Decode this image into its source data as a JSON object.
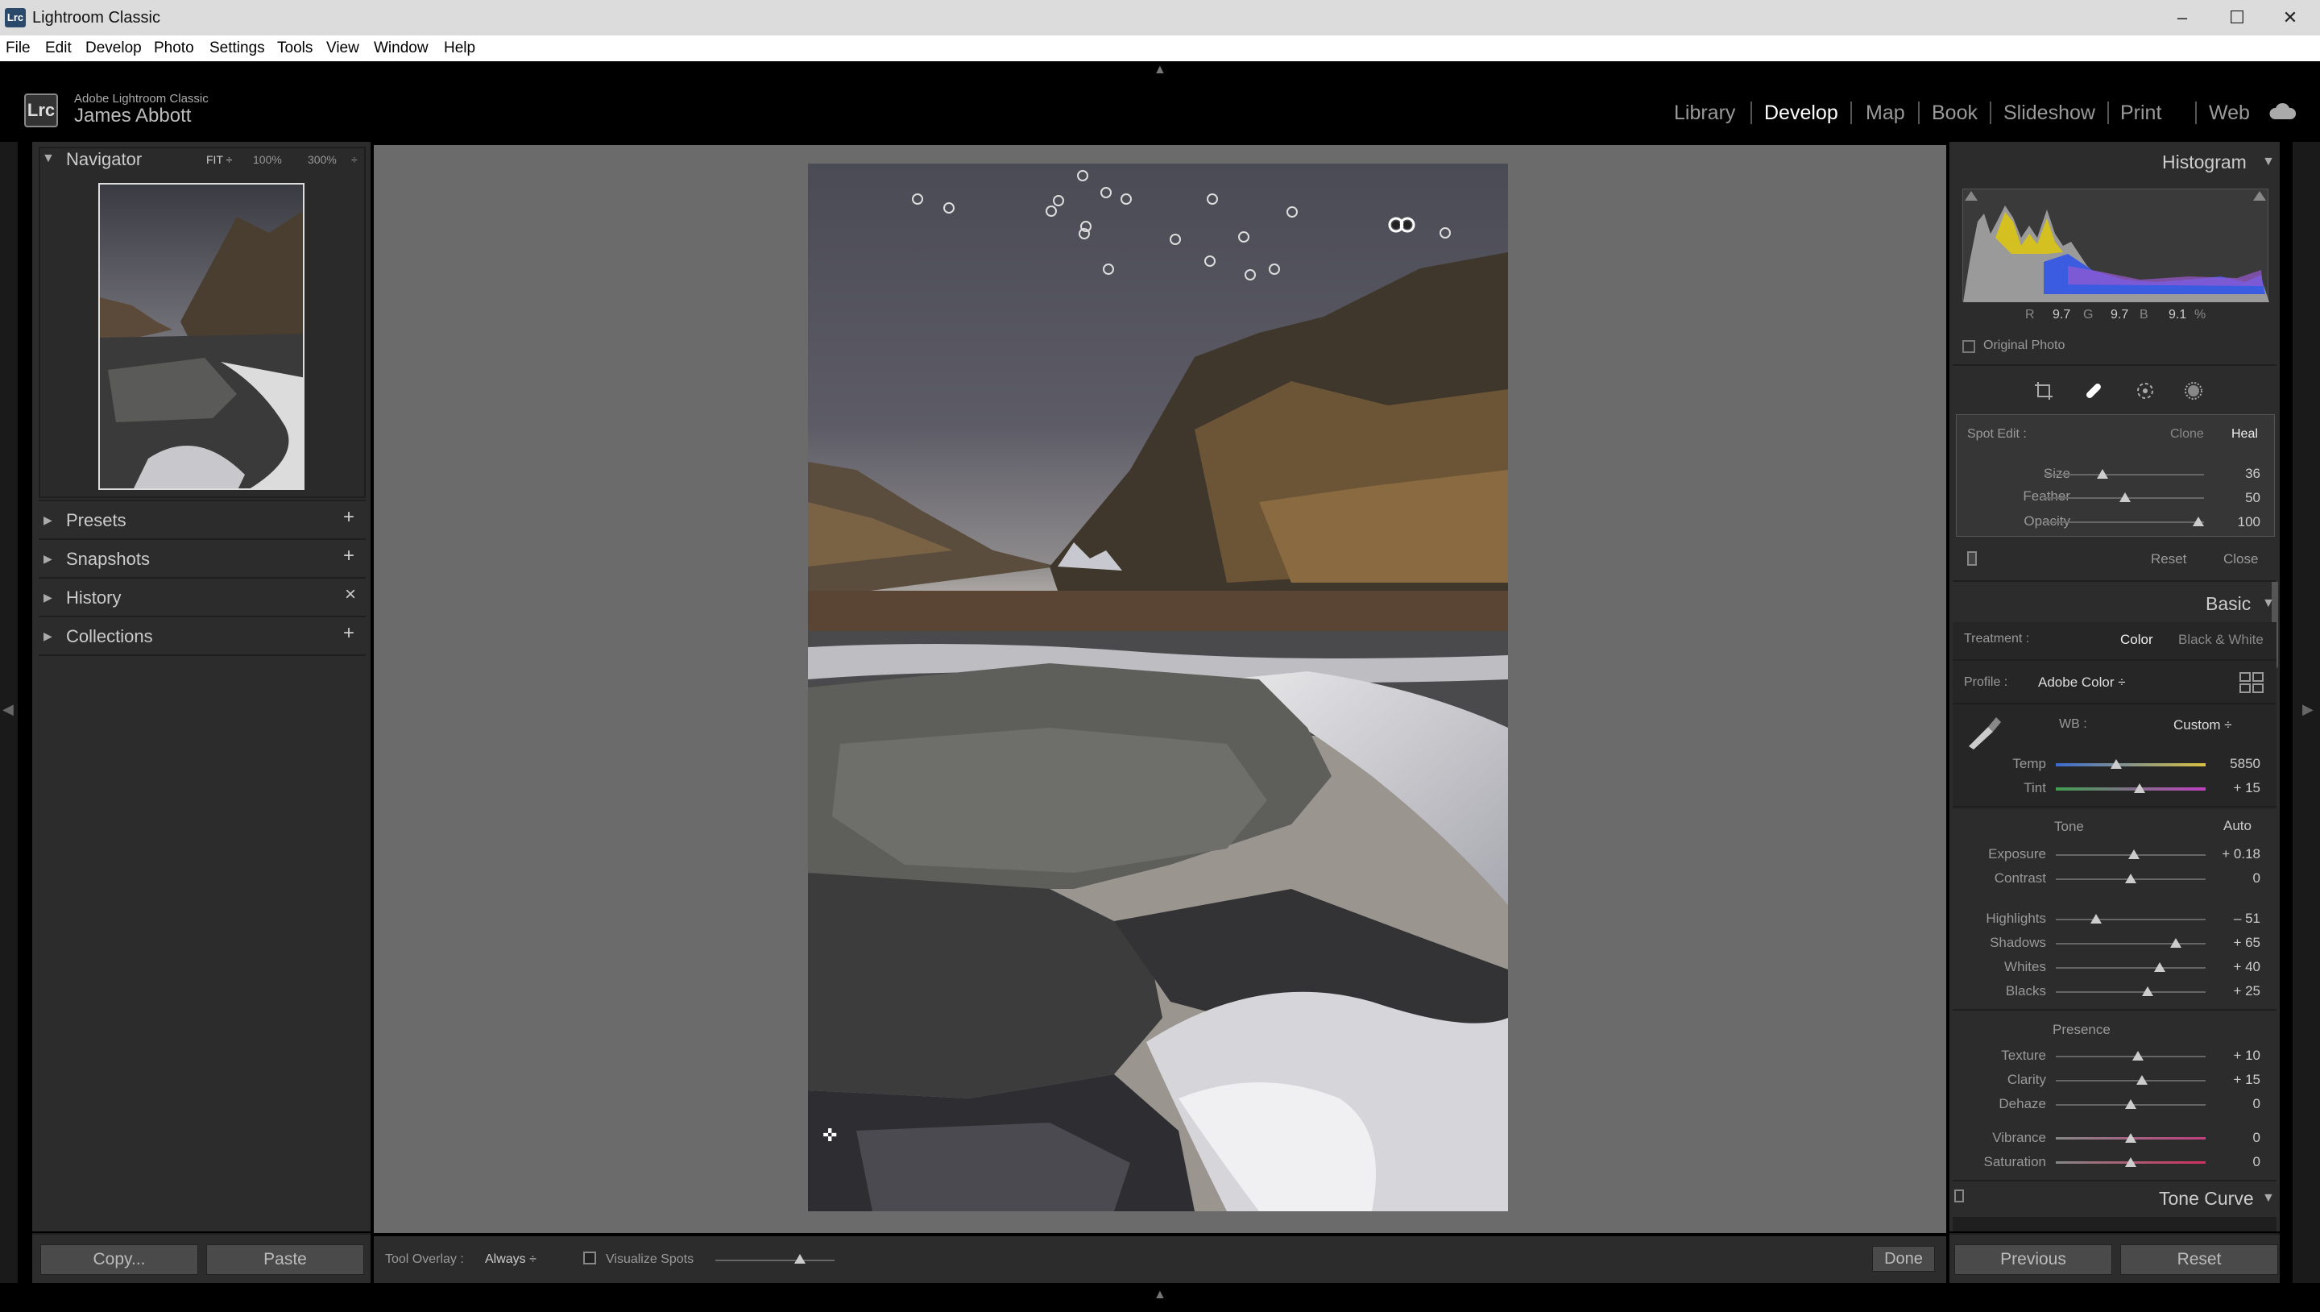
{
  "window": {
    "app_icon": "Lrc",
    "title": "Lightroom Classic",
    "controls": [
      "minimize-icon",
      "maximize-icon",
      "close-icon"
    ]
  },
  "menu": [
    "File",
    "Edit",
    "Develop",
    "Photo",
    "Settings",
    "Tools",
    "View",
    "Window",
    "Help"
  ],
  "identity": {
    "logo": "Lrc",
    "product": "Adobe Lightroom Classic",
    "user": "James Abbott"
  },
  "modules": [
    "Library",
    "Develop",
    "Map",
    "Book",
    "Slideshow",
    "Print",
    "Web"
  ],
  "active_module": "Develop",
  "navigator": {
    "title": "Navigator",
    "zoom_fit": "FIT ÷",
    "zoom_100": "100%",
    "zoom_300": "300%",
    "zoom_more": "÷"
  },
  "left_sections": [
    {
      "label": "Presets",
      "action": "+"
    },
    {
      "label": "Snapshots",
      "action": "+"
    },
    {
      "label": "History",
      "action": "×"
    },
    {
      "label": "Collections",
      "action": "+"
    }
  ],
  "left_buttons": {
    "copy": "Copy...",
    "paste": "Paste"
  },
  "toolbar": {
    "tool_overlay_label": "Tool Overlay :",
    "tool_overlay_value": "Always ÷",
    "visualize_spots_label": "Visualize Spots",
    "done": "Done"
  },
  "histogram": {
    "title": "Histogram",
    "r_label": "R",
    "r_value": "9.7",
    "g_label": "G",
    "g_value": "9.7",
    "b_label": "B",
    "b_value": "9.1",
    "percent": "%",
    "original_photo": "Original Photo"
  },
  "spot_edit": {
    "title": "Spot Edit :",
    "clone": "Clone",
    "heal": "Heal",
    "sliders": [
      {
        "label": "Size",
        "value": "36",
        "pos": 0.36
      },
      {
        "label": "Feather",
        "value": "50",
        "pos": 0.5
      },
      {
        "label": "Opacity",
        "value": "100",
        "pos": 0.97
      }
    ],
    "reset": "Reset",
    "close": "Close"
  },
  "basic": {
    "title": "Basic",
    "treatment_label": "Treatment :",
    "treatment_color": "Color",
    "treatment_bw": "Black & White",
    "profile_label": "Profile :",
    "profile_value": "Adobe Color ÷",
    "wb_label": "WB :",
    "wb_value": "Custom ÷",
    "temp": {
      "label": "Temp",
      "value": "5850",
      "pos": 0.38
    },
    "tint": {
      "label": "Tint",
      "value": "+ 15",
      "pos": 0.55
    },
    "tone_label": "Tone",
    "auto": "Auto",
    "tone_sliders": [
      {
        "label": "Exposure",
        "value": "+ 0.18",
        "pos": 0.52
      },
      {
        "label": "Contrast",
        "value": "0",
        "pos": 0.5
      },
      {
        "label": "Highlights",
        "value": "– 51",
        "pos": 0.27
      },
      {
        "label": "Shadows",
        "value": "+ 65",
        "pos": 0.8
      },
      {
        "label": "Whites",
        "value": "+ 40",
        "pos": 0.69
      },
      {
        "label": "Blacks",
        "value": "+ 25",
        "pos": 0.61
      }
    ],
    "presence_label": "Presence",
    "presence_sliders": [
      {
        "label": "Texture",
        "value": "+ 10",
        "pos": 0.55
      },
      {
        "label": "Clarity",
        "value": "+ 15",
        "pos": 0.57
      },
      {
        "label": "Dehaze",
        "value": "0",
        "pos": 0.5
      },
      {
        "label": "Vibrance",
        "value": "0",
        "pos": 0.5
      },
      {
        "label": "Saturation",
        "value": "0",
        "pos": 0.5
      }
    ]
  },
  "tone_curve": {
    "title": "Tone Curve"
  },
  "right_buttons": {
    "previous": "Previous",
    "reset": "Reset"
  }
}
